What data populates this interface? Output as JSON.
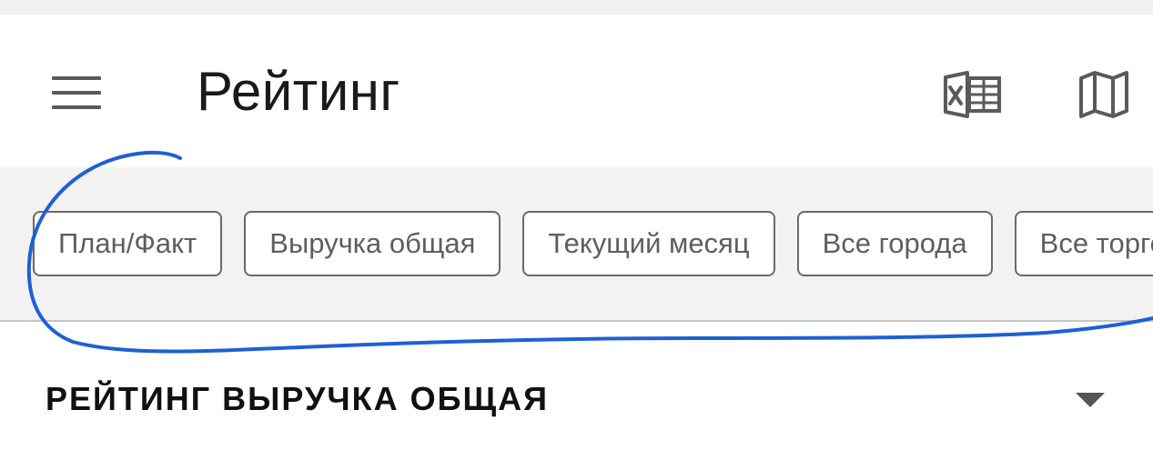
{
  "app_bar": {
    "title": "Рейтинг",
    "menu_icon": "hamburger-menu-icon",
    "excel_icon": "excel-export-icon",
    "map_icon": "map-icon"
  },
  "filters": {
    "chips": [
      "План/Факт",
      "Выручка общая",
      "Текущий месяц",
      "Все города",
      "Все торгов"
    ]
  },
  "section": {
    "title": "РЕЙТИНГ ВЫРУЧКА ОБЩАЯ",
    "toggle_icon": "chevron-down-icon"
  },
  "colors": {
    "annotation_stroke": "#1f5fd6",
    "icon_gray": "#5a5a5a",
    "chip_border": "#6a6a6a",
    "filter_bg": "#f2f2f2"
  }
}
